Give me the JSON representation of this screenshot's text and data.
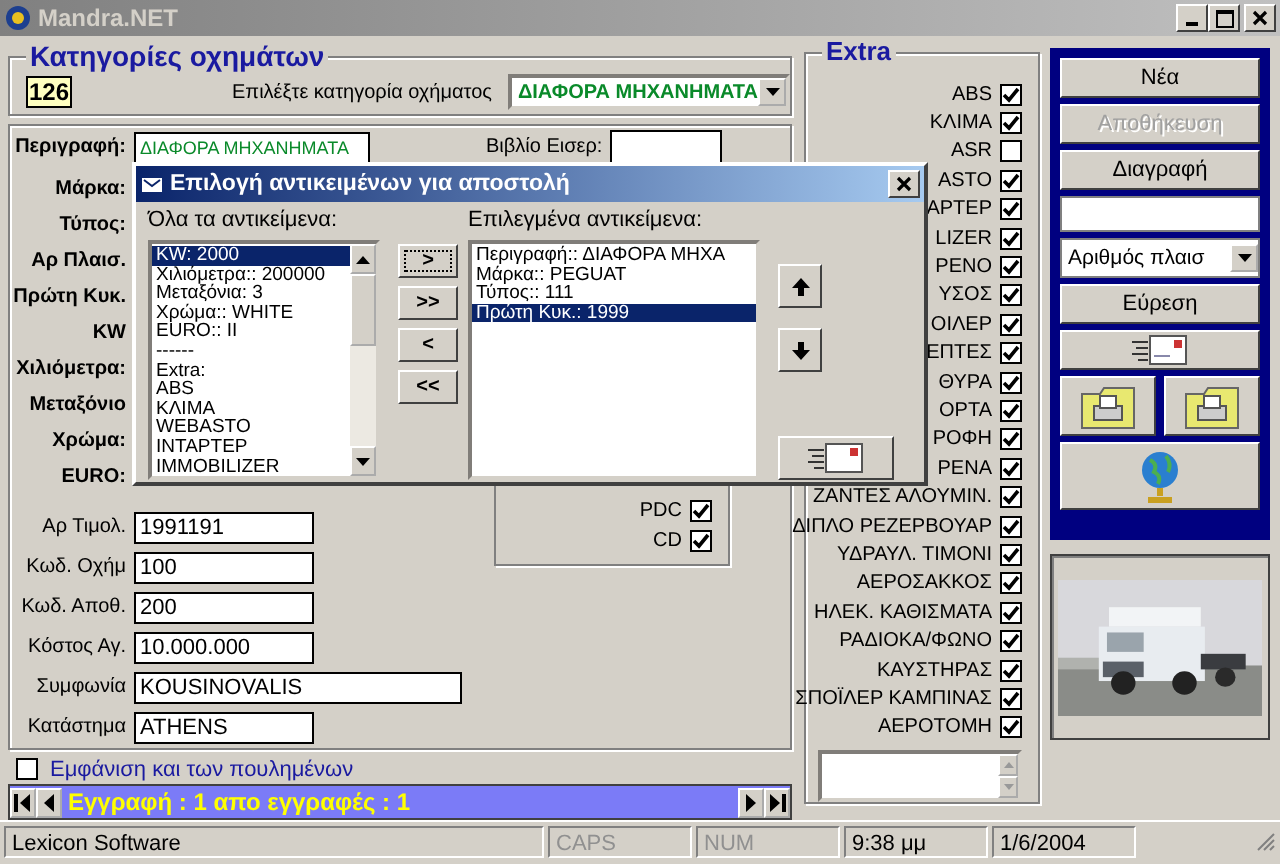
{
  "window": {
    "title": "Mandra.NET"
  },
  "category": {
    "title": "Κατηγορίες οχημάτων",
    "count": "126",
    "prompt": "Επιλέξτε κατηγορία οχήματος",
    "value": "ΔΙΑΦΟΡΑ ΜΗΧΑΝΗΜΑΤΑ"
  },
  "form": {
    "rows": [
      {
        "label": "Περιγραφή:",
        "value": "ΔΙΑΦΟΡΑ ΜΗΧΑΝΗΜΑΤΑ"
      },
      {
        "label": "Μάρκα:"
      },
      {
        "label": "Τύπος:"
      },
      {
        "label": "Αρ Πλαισ."
      },
      {
        "label": "Πρώτη Κυκ."
      },
      {
        "label": "KW"
      },
      {
        "label": "Χιλιόμετρα:"
      },
      {
        "label": "Μεταξόνιο"
      },
      {
        "label": "Χρώμα:"
      },
      {
        "label": "EURO:"
      }
    ],
    "book_label": "Βιβλίο Εισερ:",
    "details": [
      {
        "label": "Αρ Τιμολ.",
        "value": "1991191"
      },
      {
        "label": "Κωδ. Οχήμ",
        "value": "100"
      },
      {
        "label": "Κωδ. Αποθ.",
        "value": "200"
      },
      {
        "label": "Κόστος Αγ.",
        "value": "10.000.000"
      },
      {
        "label": "Συμφωνία",
        "value": "KOUSINOVALIS"
      },
      {
        "label": "Κατάστημα",
        "value": "ATHENS"
      }
    ],
    "options": [
      {
        "label": "PDC",
        "checked": true
      },
      {
        "label": "CD",
        "checked": true
      }
    ]
  },
  "extras": {
    "title": "Extra",
    "items": [
      {
        "label": "ABS",
        "checked": true
      },
      {
        "label": "ΚΛΙΜΑ",
        "checked": true
      },
      {
        "label": "ASR",
        "checked": false
      },
      {
        "label": "ASTO",
        "checked": true
      },
      {
        "label": "APTEP",
        "checked": true
      },
      {
        "label": "LIZER",
        "checked": true
      },
      {
        "label": "PENO",
        "checked": true
      },
      {
        "label": "ΥΣΟΣ",
        "checked": true
      },
      {
        "label": "ΟΙΛΕΡ",
        "checked": true
      },
      {
        "label": "ΕΠΤΕΣ",
        "checked": true
      },
      {
        "label": "ΘΥΡΑ",
        "checked": true
      },
      {
        "label": "ΟΡΤΑ",
        "checked": true
      },
      {
        "label": "ΡΟΦΗ",
        "checked": true
      },
      {
        "label": "ΡΕΝΑ",
        "checked": true
      },
      {
        "label": "ΖΑΝΤΕΣ ΑΛΟΥΜΙΝ.",
        "checked": true
      },
      {
        "label": "ΔΙΠΛΟ ΡΕΖΕΡΒΟΥΑΡ",
        "checked": true
      },
      {
        "label": "ΥΔΡΑΥΛ. ΤΙΜΟΝΙ",
        "checked": true
      },
      {
        "label": "ΑΕΡΟΣΑΚΚΟΣ",
        "checked": true
      },
      {
        "label": "ΗΛΕΚ. ΚΑΘΙΣΜΑΤΑ",
        "checked": true
      },
      {
        "label": "ΡΑΔΙΟΚΑ/ΦΩΝΟ",
        "checked": true
      },
      {
        "label": "ΚΑΥΣΤΗΡΑΣ",
        "checked": true
      },
      {
        "label": "ΣΠΟΪΛΕΡ ΚΑΜΠΙΝΑΣ",
        "checked": true
      },
      {
        "label": "ΑΕΡΟΤΟΜΗ",
        "checked": true
      }
    ]
  },
  "actions": [
    {
      "kind": "button",
      "label": "Νέα",
      "disabled": false
    },
    {
      "kind": "button",
      "label": "Αποθήκευση",
      "disabled": true
    },
    {
      "kind": "button",
      "label": "Διαγραφή",
      "disabled": false
    },
    {
      "kind": "input"
    },
    {
      "kind": "select",
      "value": "Αριθμός πλαισ"
    },
    {
      "kind": "button",
      "label": "Εύρεση",
      "disabled": false
    },
    {
      "kind": "mail"
    },
    {
      "kind": "printers"
    },
    {
      "kind": "globe"
    }
  ],
  "vehicle_photo": {
    "kind": "picture"
  },
  "show_sold": {
    "label": "Εμφάνιση και των πουλημένων",
    "checked": false
  },
  "navigator": {
    "text": "Εγγραφή : 1 απο εγγραφές : 1"
  },
  "status_bar": [
    "Lexicon Software",
    "CAPS",
    "NUM",
    "9:38 μμ",
    "1/6/2004"
  ],
  "dialog": {
    "title": "Επιλογή αντικειμένων για αποστολή",
    "all_label": "Όλα τα αντικείμενα:",
    "all_items": [
      {
        "text": "KW: 2000",
        "selected": true
      },
      {
        "text": "Χιλιόμετρα:: 200000",
        "selected": false
      },
      {
        "text": "Μεταξόνια: 3",
        "selected": false
      },
      {
        "text": "Χρώμα:: WHITE",
        "selected": false
      },
      {
        "text": "EURO:: II",
        "selected": false
      },
      {
        "text": "------",
        "selected": false
      },
      {
        "text": "Extra:",
        "selected": false
      },
      {
        "text": "ABS",
        "selected": false
      },
      {
        "text": "ΚΛΙΜΑ",
        "selected": false
      },
      {
        "text": "WEBASTO",
        "selected": false
      },
      {
        "text": "INTAPTEP",
        "selected": false
      },
      {
        "text": "IMMOBILIZER",
        "selected": false
      }
    ],
    "move_buttons": [
      ">",
      ">>",
      "<",
      "<<"
    ],
    "chosen_label": "Επιλεγμένα αντικείμενα:",
    "chosen_items": [
      {
        "text": "Περιγραφή:: ΔΙΑΦΟΡΑ ΜΗΧΑ",
        "selected": false
      },
      {
        "text": "Μάρκα:: PEGUAT",
        "selected": false
      },
      {
        "text": "Τύπος:: 111",
        "selected": false
      },
      {
        "text": "Πρώτη Κυκ.: 1999",
        "selected": true
      }
    ]
  }
}
